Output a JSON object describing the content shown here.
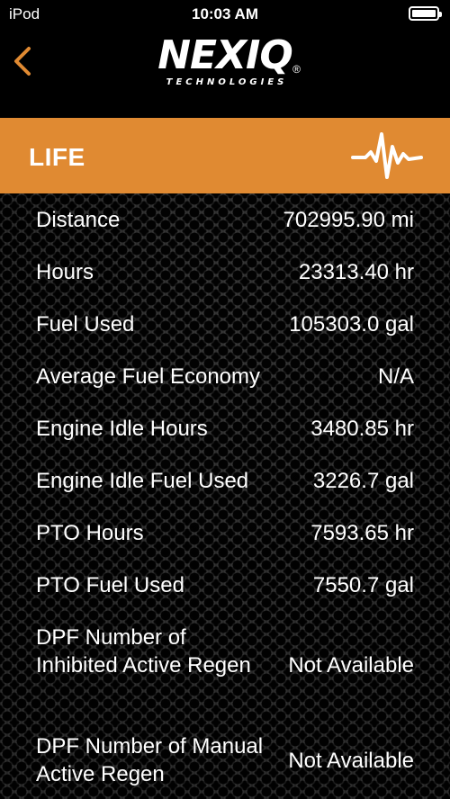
{
  "status_bar": {
    "carrier": "iPod",
    "time": "10:03 AM",
    "battery_icon": "battery-full-icon"
  },
  "nav": {
    "back_icon": "chevron-left-icon",
    "back_color": "#e08a32",
    "logo_text": "NEXIQ",
    "logo_registered": "®",
    "logo_subtext": "TECHNOLOGIES"
  },
  "section": {
    "title": "LIFE",
    "icon": "pulse-waveform-icon",
    "accent_color": "#e08a32"
  },
  "rows": [
    {
      "label": "Distance",
      "value": "702995.90 mi"
    },
    {
      "label": "Hours",
      "value": "23313.40 hr"
    },
    {
      "label": "Fuel Used",
      "value": "105303.0 gal"
    },
    {
      "label": "Average Fuel Economy",
      "value": "N/A"
    },
    {
      "label": "Engine Idle Hours",
      "value": "3480.85 hr"
    },
    {
      "label": "Engine Idle Fuel Used",
      "value": "3226.7 gal"
    },
    {
      "label": "PTO Hours",
      "value": "7593.65 hr"
    },
    {
      "label": "PTO Fuel Used",
      "value": "7550.7 gal"
    },
    {
      "label": "DPF Number of Inhibited Active Regen",
      "value": "Not Available"
    },
    {
      "label": "DPF Number of Manual Active Regen",
      "value": "Not Available"
    }
  ]
}
